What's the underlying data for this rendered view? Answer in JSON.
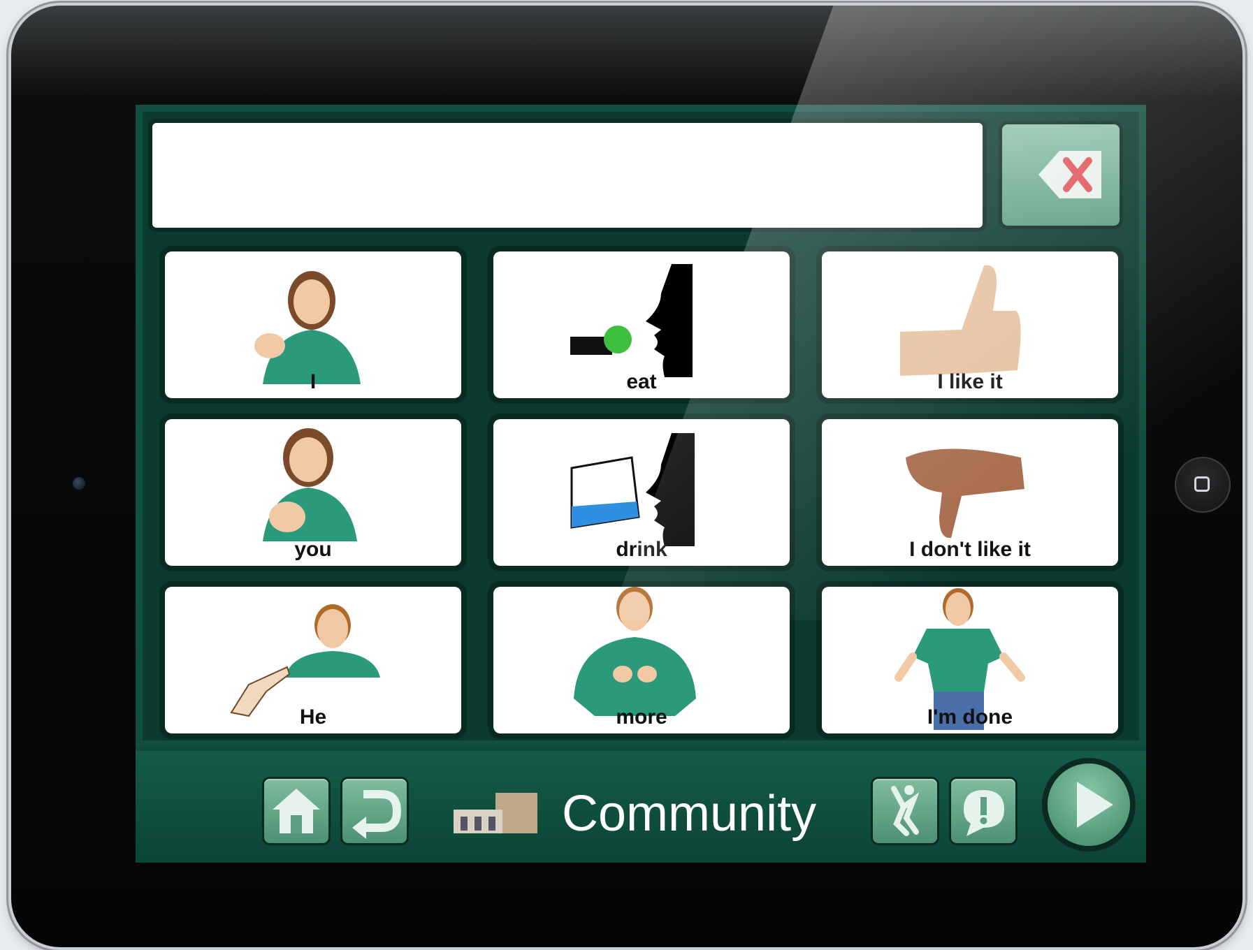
{
  "message_bar": {
    "text": ""
  },
  "backspace": {
    "icon": "backspace-icon"
  },
  "tiles": [
    {
      "label": "I"
    },
    {
      "label": "eat"
    },
    {
      "label": "I like it"
    },
    {
      "label": "you"
    },
    {
      "label": "drink"
    },
    {
      "label": "I don't like it"
    },
    {
      "label": "He"
    },
    {
      "label": "more"
    },
    {
      "label": "I'm done"
    }
  ],
  "toolbar": {
    "home_icon": "home-icon",
    "back_icon": "undo-icon",
    "category_label": "Community",
    "category_icon": "building-icon",
    "action_icon": "jump-icon",
    "alert_icon": "exclamation-bubble-icon",
    "speak_icon": "play-icon"
  },
  "colors": {
    "screen_bg": "#0f4a3c",
    "button_green": "#6aaa8c",
    "shirt_green": "#2a9a7a"
  }
}
